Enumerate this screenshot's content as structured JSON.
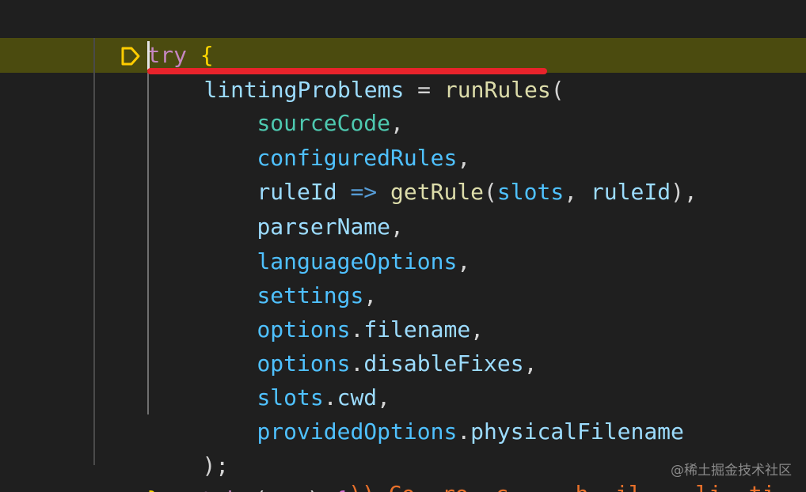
{
  "colors": {
    "background": "#1f1f1f",
    "debug_highlight": "#4b4b0f",
    "keyword": "#c586c0",
    "variable": "#9cdcfe",
    "function": "#dcdcaa",
    "property": "#4fc1ff",
    "underline": "#e8232b",
    "breakpoint": "#ffcc00"
  },
  "icons": {
    "breakpoint": "debug-stackframe-icon"
  },
  "code": {
    "try_kw": "try",
    "open_brace": "{",
    "assign_var": "lintingProblems",
    "assign_op": " = ",
    "call_fn": "runRules",
    "call_open": "(",
    "args": [
      {
        "text": "sourceCode",
        "suffix": ","
      },
      {
        "text": "configuredRules",
        "suffix": ","
      },
      {
        "text": "providedOptions",
        "suffix": ""
      }
    ],
    "arg1": "sourceCode",
    "arg2": "configuredRules",
    "arrow_param": "ruleId",
    "arrow": " => ",
    "arrow_fn": "getRule",
    "arrow_arg1": "slots",
    "arrow_sep": ", ",
    "arrow_arg2": "ruleId",
    "arrow_close": "),",
    "arg4": "parserName",
    "arg5": "languageOptions",
    "arg6": "settings",
    "arg7_obj": "options",
    "arg7_prop": "filename",
    "arg8_obj": "options",
    "arg8_prop": "disableFixes",
    "arg9_obj": "slots",
    "arg9_prop": "cwd",
    "arg10_obj": "providedOptions",
    "arg10_prop": "physicalFilename",
    "comma": ",",
    "dot": ".",
    "call_end": ");",
    "close_brace": "}",
    "catch_kw": "catch",
    "catch_open": " (",
    "catch_param": "err",
    "catch_close": ") ",
    "catch_brace": "{",
    "cutoff_text": ")) Co  ro  c     h  il    li  ti      tf  ti"
  },
  "watermark": "@稀土掘金技术社区"
}
